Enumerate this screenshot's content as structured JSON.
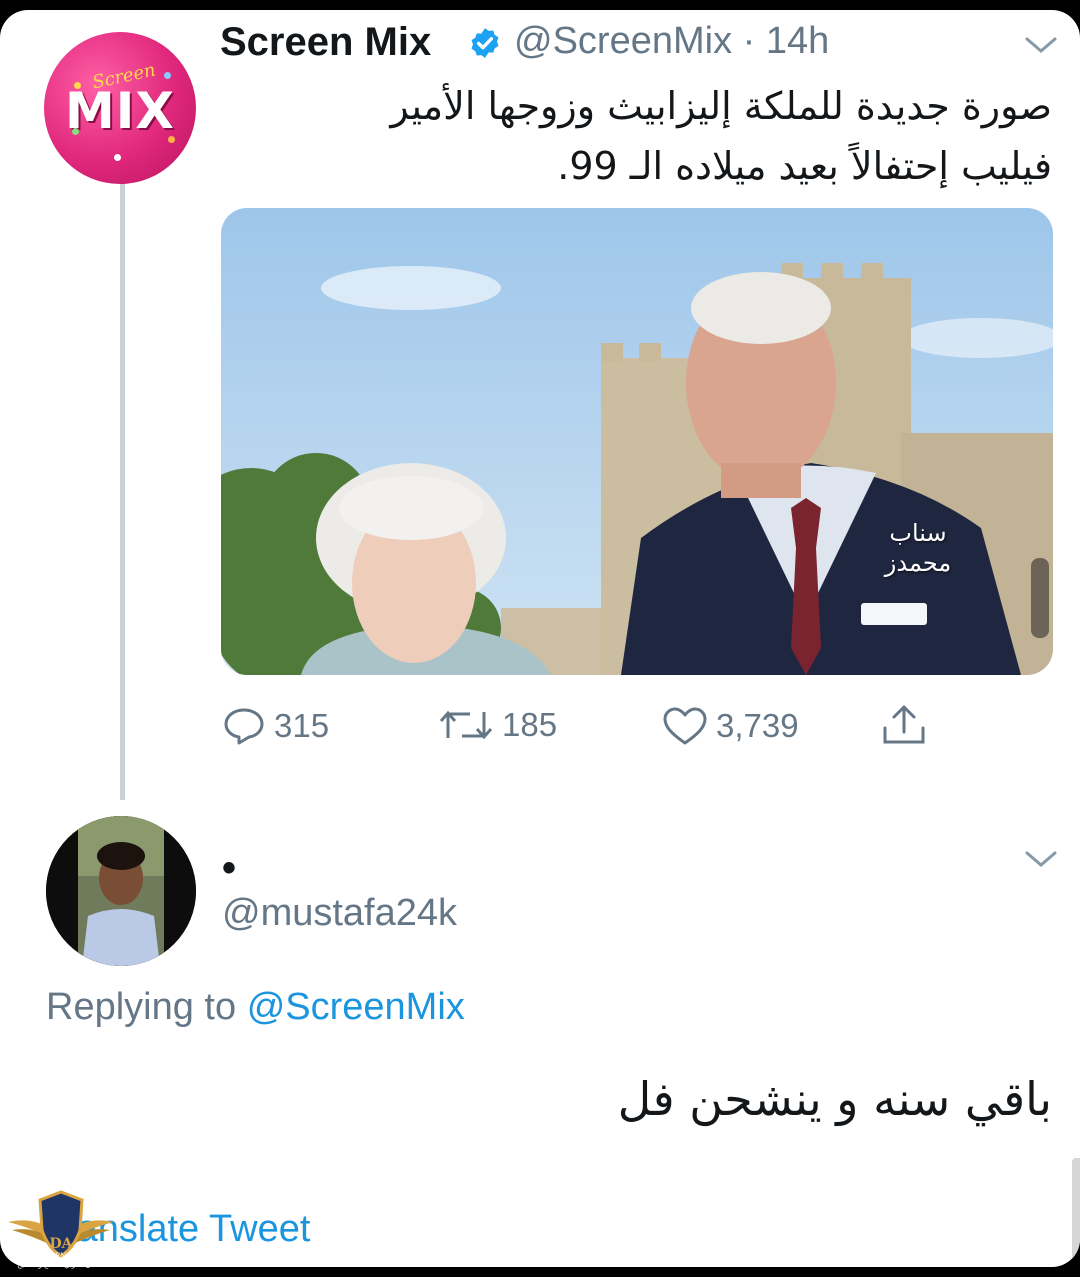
{
  "tweet": {
    "author_name": "Screen Mix",
    "handle_time": "@ScreenMix · 14h",
    "avatar_script": "Screen",
    "avatar_text": "MIX",
    "text_line1": "صورة جديدة للملكة إليزابيث وزوجها الأمير",
    "text_line2": "فيليب إحتفالاً بعيد ميلاده الـ 99.",
    "image_watermark_line1": "سناب",
    "image_watermark_line2": "محمدز",
    "counts": {
      "replies": "315",
      "retweets": "185",
      "likes": "3,739"
    }
  },
  "reply": {
    "display_name": "•",
    "handle": "@mustafa24k",
    "replying_label": "Replying to",
    "replying_handle": "@ScreenMix",
    "text": "باقي سنه و ينشحن فل",
    "translate_label": "ranslate Tweet"
  },
  "overlay_logo": {
    "initials": "DA",
    "caption_en": "ARAB DEFENSE FORUM",
    "caption_ar": "المنتدى العربي للدفاع والتسليح"
  },
  "icons": [
    "verified-badge-icon",
    "chevron-down-icon",
    "reply-icon",
    "retweet-icon",
    "like-icon",
    "share-icon"
  ],
  "colors": {
    "text": "#14171a",
    "secondary": "#657786",
    "link": "#1b95e0",
    "verified": "#1da1f2",
    "avatar_brand": "#e0277c"
  }
}
